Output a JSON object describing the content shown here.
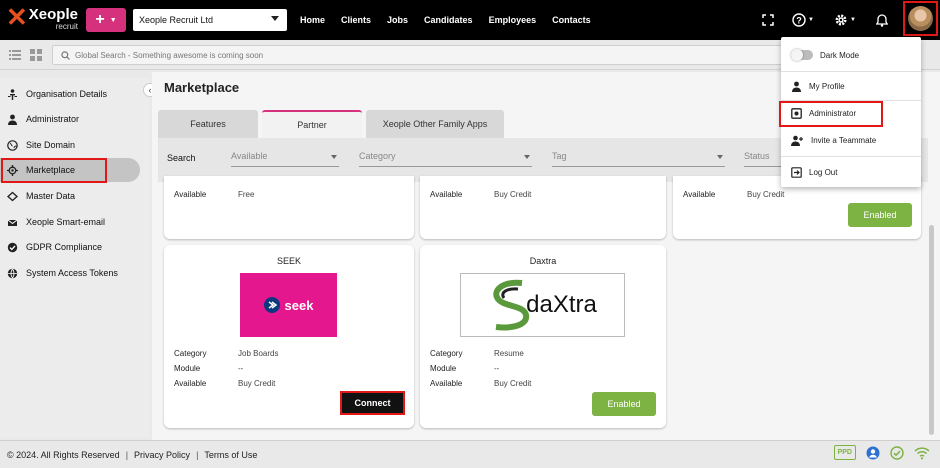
{
  "topbar": {
    "logo_word": "Xeople",
    "logo_sub": "recruit",
    "company": "Xeople Recruit Ltd",
    "nav": [
      "Home",
      "Clients",
      "Jobs",
      "Candidates",
      "Employees",
      "Contacts"
    ]
  },
  "search": {
    "placeholder": "Global Search - Something awesome is coming soon"
  },
  "sidebar": {
    "items": [
      {
        "label": "Organisation Details",
        "icon": "person-tree-icon"
      },
      {
        "label": "Administrator",
        "icon": "person-icon"
      },
      {
        "label": "Site Domain",
        "icon": "globe-icon"
      },
      {
        "label": "Marketplace",
        "icon": "crosshair-icon"
      },
      {
        "label": "Master Data",
        "icon": "database-icon"
      },
      {
        "label": "Xeople Smart-email",
        "icon": "mail-icon"
      },
      {
        "label": "GDPR Compliance",
        "icon": "globe-check-icon"
      },
      {
        "label": "System Access Tokens",
        "icon": "globe-icon"
      }
    ]
  },
  "page": {
    "title": "Marketplace",
    "tabs": [
      "Features",
      "Partner",
      "Xeople Other Family Apps"
    ],
    "filter": {
      "label": "Search",
      "dropdowns": [
        "Available",
        "Category",
        "Tag",
        "Status"
      ]
    }
  },
  "cards_top": [
    {
      "available_label": "Available",
      "available_value": "Free"
    },
    {
      "available_label": "Available",
      "available_value": "Buy Credit"
    },
    {
      "available_label": "Available",
      "available_value": "Buy Credit",
      "button": "Enabled"
    }
  ],
  "cards": [
    {
      "title": "SEEK",
      "logo_text": "seek",
      "category_label": "Category",
      "category": "Job Boards",
      "module_label": "Module",
      "module": "--",
      "available_label": "Available",
      "available": "Buy Credit",
      "button": "Connect"
    },
    {
      "title": "Daxtra",
      "logo_text": "daXtra",
      "category_label": "Category",
      "category": "Resume",
      "module_label": "Module",
      "module": "--",
      "available_label": "Available",
      "available": "Buy Credit",
      "button": "Enabled"
    }
  ],
  "user_menu": {
    "dark_mode": "Dark Mode",
    "my_profile": "My Profile",
    "administrator": "Administrator",
    "invite": "Invite a Teammate",
    "logout": "Log Out"
  },
  "footer": {
    "copyright": "© 2024. All Rights Reserved",
    "privacy": "Privacy Policy",
    "terms": "Terms of Use",
    "ppd": "PPD"
  },
  "colors": {
    "brand_pink": "#d6317c",
    "brand_orange": "#e8501f",
    "enabled_green": "#7cb342",
    "highlight_red": "#e01818"
  }
}
